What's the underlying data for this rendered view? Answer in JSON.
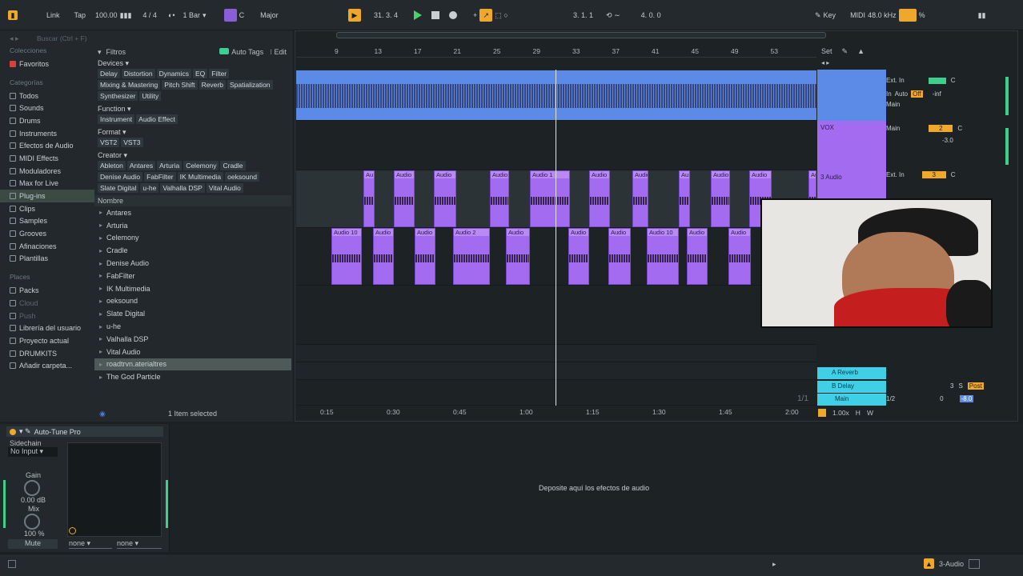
{
  "transport": {
    "link": "Link",
    "tap": "Tap",
    "tempo": "100.00",
    "signature": "4 / 4",
    "quantize": "1 Bar",
    "key_root": "C",
    "scale": "Major",
    "position": "31.   3.   4",
    "loop_start": "3.   1.   1",
    "loop_length": "4.   0.   0",
    "key_label": "Key",
    "midi_label": "MIDI",
    "sample_rate": "48.0 kHz",
    "cpu_label": "%"
  },
  "browser": {
    "search_placeholder": "Buscar (Ctrl + F)",
    "collections_header": "Colecciones",
    "favorites": "Favoritos",
    "categories_header": "Categorías",
    "categories": [
      "Todos",
      "Sounds",
      "Drums",
      "Instruments",
      "Efectos de Audio",
      "MIDI Effects",
      "Moduladores",
      "Max for Live",
      "Plug-ins",
      "Clips",
      "Samples",
      "Grooves",
      "Afinaciones",
      "Plantillas"
    ],
    "places_header": "Places",
    "places": [
      "Packs",
      "Cloud",
      "Push",
      "Librería del usuario",
      "Proyecto actual",
      "DRUMKITS",
      "Añadir carpeta..."
    ],
    "filters_label": "Filtros",
    "auto_tags": "Auto Tags",
    "edit": "Edit",
    "devices_label": "Devices ▾",
    "device_tags": [
      "Delay",
      "Distortion",
      "Dynamics",
      "EQ",
      "Filter",
      "Mixing & Mastering",
      "Pitch Shift",
      "Reverb",
      "Spatialization",
      "Synthesizer",
      "Utility"
    ],
    "function_label": "Function ▾",
    "function_tags": [
      "Instrument",
      "Audio Effect"
    ],
    "format_label": "Format ▾",
    "format_tags": [
      "VST2",
      "VST3"
    ],
    "creator_label": "Creator ▾",
    "creator_tags": [
      "Ableton",
      "Antares",
      "Arturia",
      "Celemony",
      "Cradle",
      "Denise Audio",
      "FabFilter",
      "IK Multimedia",
      "oeksound",
      "Slate Digital",
      "u-he",
      "Valhalla DSP",
      "Vital Audio"
    ],
    "name_header": "Nombre",
    "tree": [
      "Antares",
      "Arturia",
      "Celemony",
      "Cradle",
      "Denise Audio",
      "FabFilter",
      "IK Multimedia",
      "oeksound",
      "Slate Digital",
      "u-he",
      "Valhalla DSP",
      "Vital Audio",
      "roadtrvn.aterialtres",
      "The God Particle"
    ],
    "status": "1 Item selected"
  },
  "arrangement": {
    "ruler": [
      "9",
      "13",
      "17",
      "21",
      "25",
      "29",
      "33",
      "37",
      "41",
      "45",
      "49",
      "53"
    ],
    "set_label": "Set",
    "time_marks": [
      "0:15",
      "0:30",
      "0:45",
      "1:00",
      "1:15",
      "1:30",
      "1:45",
      "2:00"
    ],
    "clip_labels": [
      "Au",
      "Audio",
      "Audio",
      "Audio",
      "Audio 1",
      "Audio",
      "Audio",
      "Au",
      "Audio",
      "Audio",
      "Au"
    ],
    "clip_labels_row2": [
      "Audio 10",
      "Audio",
      "Audio",
      "Audio 2",
      "Audio",
      "Audio",
      "Audio",
      "Audio 10",
      "Audio",
      "Audio"
    ],
    "zoom": "1.00x",
    "page_fraction": "1/1"
  },
  "tracks": [
    {
      "name": "",
      "input": "Ext. In",
      "monitor": [
        "In",
        "Auto",
        "Off"
      ],
      "output": "Main",
      "vol": "0",
      "pan": "C",
      "send": "-inf"
    },
    {
      "name": "VOX",
      "output": "Main",
      "vol": "2",
      "pan": "C",
      "send": "-3.0"
    },
    {
      "name": "3 Audio",
      "input": "Ext. In",
      "vol": "3",
      "pan": "C"
    },
    {
      "name": "A Reverb",
      "vol": "",
      "pan": ""
    },
    {
      "name": "B Delay",
      "vol": "3",
      "pan": "S",
      "post": "Post"
    },
    {
      "name": "Main",
      "output": "1/2",
      "vol": "0",
      "pan": "-8.0"
    }
  ],
  "device": {
    "name": "Auto-Tune Pro",
    "sidechain_label": "Sidechain",
    "sidechain_value": "No Input",
    "gain_label": "Gain",
    "gain_value": "0.00 dB",
    "mix_label": "Mix",
    "mix_value": "100 %",
    "mute": "Mute",
    "sel1": "none",
    "sel2": "none",
    "drop_hint": "Deposite aquí los efectos de audio"
  },
  "status_bar": {
    "track": "3-Audio"
  },
  "colors": {
    "accent": "#f0a82a",
    "clip": "#a36cf0",
    "track_blue": "#5b8be6",
    "return_cyan": "#3fd0e8"
  }
}
